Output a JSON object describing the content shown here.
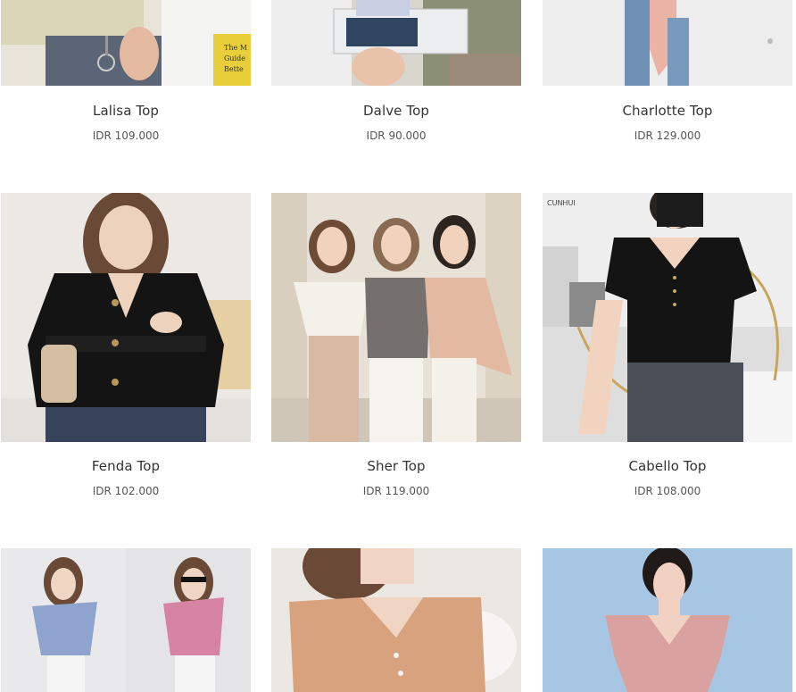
{
  "products": [
    {
      "name": "Lalisa Top",
      "price": "IDR 109.000"
    },
    {
      "name": "Dalve Top",
      "price": "IDR 90.000"
    },
    {
      "name": "Charlotte Top",
      "price": "IDR 129.000"
    },
    {
      "name": "Fenda Top",
      "price": "IDR 102.000"
    },
    {
      "name": "Sher Top",
      "price": "IDR 119.000"
    },
    {
      "name": "Cabello Top",
      "price": "IDR 108.000"
    },
    {
      "name": "",
      "price": ""
    },
    {
      "name": "",
      "price": ""
    },
    {
      "name": "",
      "price": ""
    }
  ],
  "image_texts": {
    "book_cover": "The M Guide Bette",
    "brand_watermark": "CUNHUI"
  },
  "colors": {
    "product_name": "#333333",
    "price": "#555555",
    "background": "#ffffff"
  }
}
